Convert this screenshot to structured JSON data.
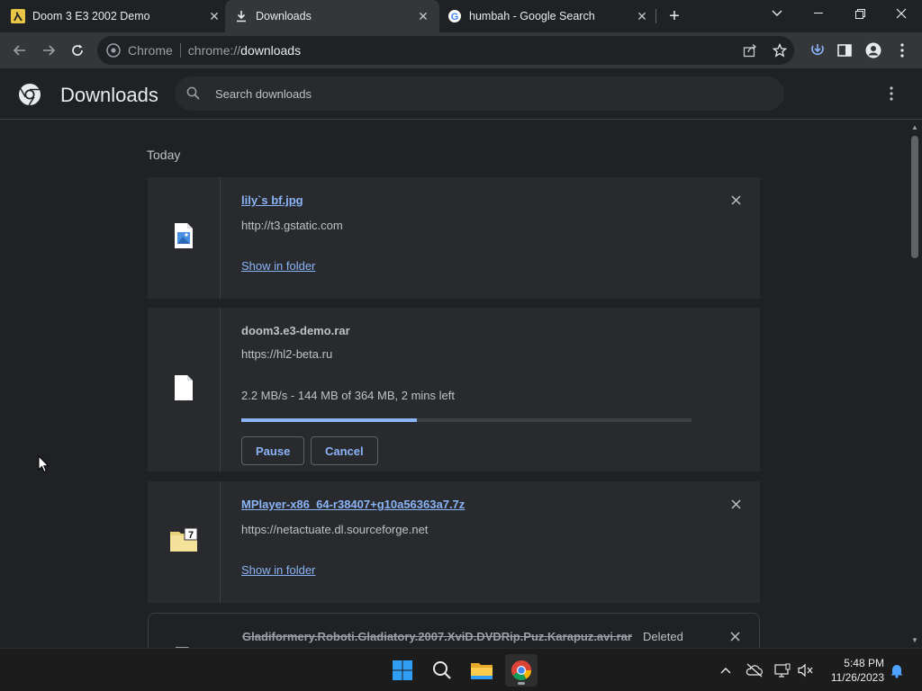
{
  "tabs": [
    {
      "title": "Doom 3 E3 2002 Demo",
      "favicon": "lambda-icon",
      "active": false
    },
    {
      "title": "Downloads",
      "favicon": "download-icon",
      "active": true
    },
    {
      "title": "humbah - Google Search",
      "favicon": "google-icon",
      "active": false
    }
  ],
  "omnibox": {
    "chip": "Chrome",
    "url_scheme": "chrome://",
    "url_host": "downloads"
  },
  "header": {
    "title": "Downloads",
    "search_placeholder": "Search downloads"
  },
  "section": {
    "date": "Today"
  },
  "downloads": [
    {
      "filename": "lily`s bf.jpg",
      "url": "http://t3.gstatic.com",
      "action": "Show in folder",
      "icon": "image-file-icon"
    },
    {
      "filename": "doom3.e3-demo.rar",
      "url": "https://hl2-beta.ru",
      "progress_text": "2.2 MB/s - 144 MB of 364 MB, 2 mins left",
      "progress": 0.39,
      "pause_label": "Pause",
      "cancel_label": "Cancel",
      "icon": "blank-file-icon"
    },
    {
      "filename": "MPlayer-x86_64-r38407+g10a56363a7.7z",
      "url": "https://netactuate.dl.sourceforge.net",
      "action": "Show in folder",
      "icon": "7z-archive-icon"
    },
    {
      "filename": "Gladiformery.Roboti.Gladiatory.2007.XviD.DVDRip.Puz.Karapuz.avi.rar",
      "status": "Deleted",
      "icon": "blank-file-icon"
    }
  ],
  "taskbar": {
    "time": "5:48 PM",
    "date": "11/26/2023"
  },
  "colors": {
    "accent": "#8ab4f8",
    "background": "#202124",
    "card": "#292a2d"
  }
}
